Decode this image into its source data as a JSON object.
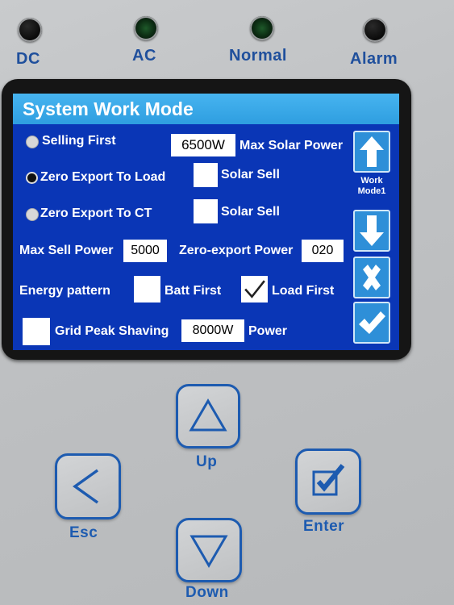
{
  "indicators": [
    {
      "label": "DC",
      "state": "off"
    },
    {
      "label": "AC",
      "state": "green"
    },
    {
      "label": "Normal",
      "state": "green"
    },
    {
      "label": "Alarm",
      "state": "off"
    }
  ],
  "screen": {
    "title": "System Work Mode",
    "selling_first_label": "Selling First",
    "zero_export_load_label": "Zero Export To Load",
    "zero_export_ct_label": "Zero Export To CT",
    "selected_mode": "Zero Export To Load",
    "max_solar_power_value": "6500W",
    "max_solar_power_label": "Max Solar Power",
    "solar_sell_label": "Solar Sell",
    "max_sell_power_label": "Max Sell Power",
    "max_sell_power_value": "5000",
    "zero_export_power_label": "Zero-export Power",
    "zero_export_power_value": "020",
    "energy_pattern_label": "Energy pattern",
    "batt_first_label": "Batt First",
    "load_first_label": "Load First",
    "grid_peak_shaving_label": "Grid Peak Shaving",
    "grid_peak_shaving_value": "8000W",
    "power_label": "Power",
    "side_work_mode_line1": "Work",
    "side_work_mode_line2": "Mode1"
  },
  "keys": {
    "up": "Up",
    "esc": "Esc",
    "enter": "Enter",
    "down": "Down"
  },
  "colors": {
    "screen_bg": "#0a36b6",
    "title_bar": "#2e9ee0",
    "key_blue": "#1d5bb0"
  }
}
